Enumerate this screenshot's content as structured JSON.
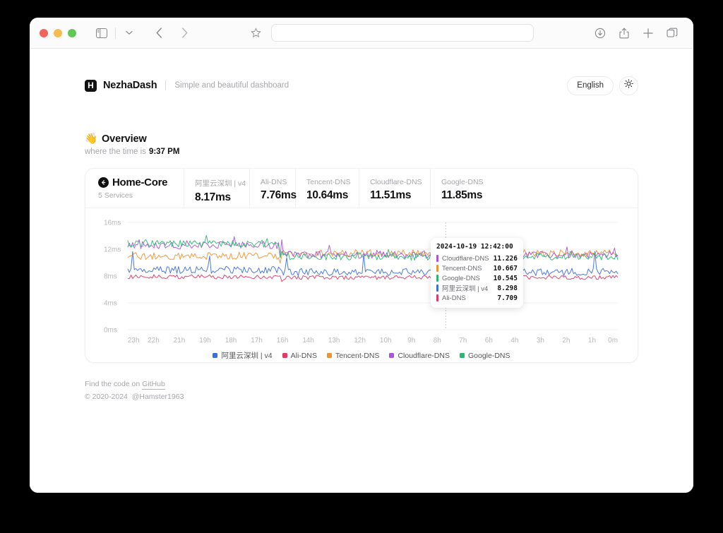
{
  "browser": {
    "address_value": "",
    "address_placeholder": "",
    "icons": {
      "sidebar": "sidebar-icon",
      "chevron": "chevron-down-icon",
      "back": "back-arrow-icon",
      "forward": "forward-arrow-icon",
      "bookmark": "star-icon",
      "download": "download-icon",
      "share": "share-icon",
      "newtab": "plus-icon",
      "tabs": "tab-overview-icon"
    }
  },
  "site": {
    "brand_name": "NezhaDash",
    "brand_logo_letter": "H",
    "tagline": "Simple and beautiful dashboard",
    "language_label": "English",
    "theme_icon": "sun-icon"
  },
  "overview": {
    "emoji": "👋",
    "title": "Overview",
    "subtitle_prefix": "where the time is",
    "clock": "9:37 PM"
  },
  "card": {
    "group_name": "Home-Core",
    "group_sub": "5 Services",
    "back_icon": "back-arrow-circle-icon",
    "metrics": [
      {
        "label": "阿里云深圳 | v4",
        "value": "8.17ms"
      },
      {
        "label": "Ali-DNS",
        "value": "7.76ms"
      },
      {
        "label": "Tencent-DNS",
        "value": "10.64ms"
      },
      {
        "label": "Cloudflare-DNS",
        "value": "11.51ms"
      },
      {
        "label": "Google-DNS",
        "value": "11.85ms"
      }
    ]
  },
  "chart_data": {
    "type": "line",
    "title": "",
    "xlabel": "",
    "ylabel": "",
    "ylim": [
      0,
      16
    ],
    "ytick_labels": [
      "16ms",
      "12ms",
      "8ms",
      "4ms",
      "0ms"
    ],
    "ytick_values": [
      16,
      12,
      8,
      4,
      0
    ],
    "xtick_labels": [
      "23h",
      "22h",
      "21h",
      "19h",
      "18h",
      "17h",
      "16h",
      "14h",
      "13h",
      "12h",
      "10h",
      "9h",
      "8h",
      "7h",
      "6h",
      "4h",
      "3h",
      "2h",
      "1h",
      "0m"
    ],
    "grid": true,
    "legend_position": "bottom",
    "series": [
      {
        "name": "阿里云深圳 | v4",
        "color": "#3b6fe0",
        "current": 8.17,
        "hover": 8.298,
        "baseline_early": 8.9,
        "baseline_late": 8.6
      },
      {
        "name": "Ali-DNS",
        "color": "#e03a67",
        "current": 7.76,
        "hover": 7.709,
        "baseline_early": 7.9,
        "baseline_late": 7.8
      },
      {
        "name": "Tencent-DNS",
        "color": "#ef9234",
        "current": 10.64,
        "hover": 10.667,
        "baseline_early": 11.0,
        "baseline_late": 11.4
      },
      {
        "name": "Cloudflare-DNS",
        "color": "#a855d8",
        "current": 11.51,
        "hover": 11.226,
        "baseline_early": 12.6,
        "baseline_late": 11.2
      },
      {
        "name": "Google-DNS",
        "color": "#2bb673",
        "current": 11.85,
        "hover": 10.545,
        "baseline_early": 12.8,
        "baseline_late": 10.9
      }
    ]
  },
  "tooltip": {
    "date": "2024-10-19 12:42:00",
    "rows": [
      {
        "name": "Cloudflare-DNS",
        "value": "11.226",
        "color": "#a855d8"
      },
      {
        "name": "Tencent-DNS",
        "value": "10.667",
        "color": "#ef9234"
      },
      {
        "name": "Google-DNS",
        "value": "10.545",
        "color": "#2bb673"
      },
      {
        "name": "阿里云深圳 | v4",
        "value": "8.298",
        "color": "#3b6fe0"
      },
      {
        "name": "Ali-DNS",
        "value": "7.709",
        "color": "#e03a67"
      }
    ]
  },
  "footer": {
    "find_code_prefix": "Find the code on",
    "github_label": "GitHub",
    "copyright": "© 2020-2024",
    "author": "@Hamster1963"
  }
}
